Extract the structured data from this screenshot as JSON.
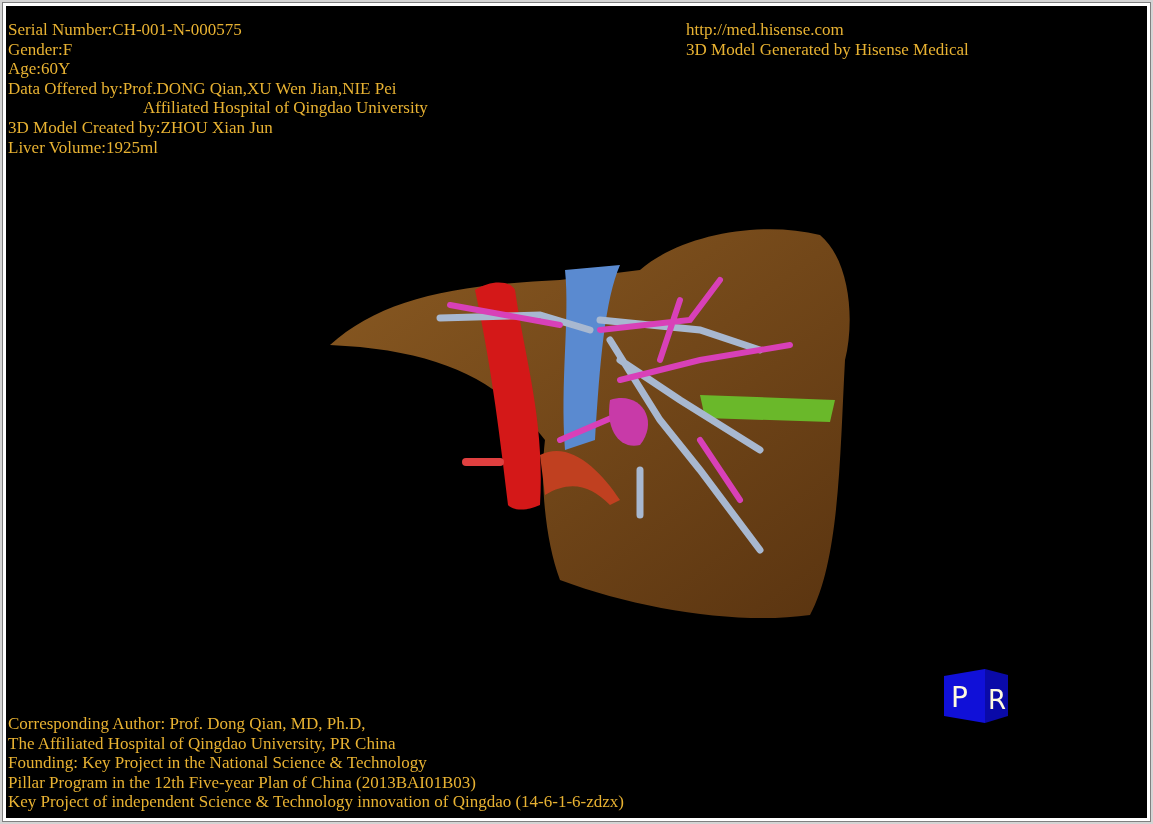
{
  "header_info": [
    {
      "kind": "line",
      "text": "Serial Number:CH-001-N-000575"
    },
    {
      "kind": "line",
      "text": "Gender:F"
    },
    {
      "kind": "line",
      "text": "Age:60Y"
    },
    {
      "kind": "line",
      "text": "Data Offered by:Prof.DONG Qian,XU Wen Jian,NIE Pei"
    },
    {
      "kind": "continuation",
      "text": "Affiliated Hospital of Qingdao University"
    },
    {
      "kind": "line",
      "text": "3D Model Created by:ZHOU Xian Jun"
    },
    {
      "kind": "line",
      "text": "Liver Volume:1925ml"
    }
  ],
  "website": {
    "url": "http://med.hisense.com",
    "note": "3D Model Generated by Hisense Medical"
  },
  "orientation_cube": {
    "front": "P",
    "side": "R"
  },
  "credits": [
    "Corresponding Author: Prof. Dong Qian, MD, Ph.D,",
    "The Affiliated Hospital of Qingdao University, PR China",
    "Founding: Key Project in the National Science & Technology",
    "Pillar Program in the 12th Five-year Plan of China (2013BAI01B03)",
    "Key Project of independent Science & Technology innovation of Qingdao (14-6-1-6-zdzx)"
  ]
}
